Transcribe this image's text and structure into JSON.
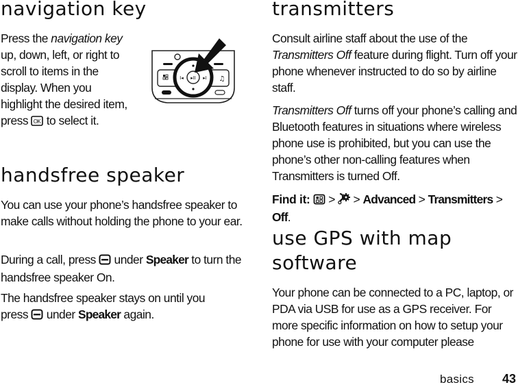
{
  "left": {
    "nav_heading": "navigation key",
    "nav_p1_a": "Press the ",
    "nav_p1_em": "navigation key",
    "nav_p1_b": " up, down, left, or right to scroll to items in the display. When you highlight the desired item, press ",
    "nav_p1_c": " to select it.",
    "ok_key_label": "OK",
    "speaker_heading": "handsfree speaker",
    "speaker_p1": "You can use your phone’s handsfree speaker to make calls without holding the phone to your ear.",
    "speaker_p2_a": "During a call, press ",
    "speaker_p2_b": " under ",
    "speaker_p2_strong": "Speaker",
    "speaker_p2_c": " to turn the handsfree speaker On.",
    "speaker_p3_a": "The handsfree speaker stays on until you press ",
    "speaker_p3_b": " under ",
    "speaker_p3_strong": "Speaker",
    "speaker_p3_c": " again."
  },
  "right": {
    "trans_heading": "transmitters",
    "trans_p1_a": "Consult airline staff about the use of the ",
    "trans_p1_em": "Transmitters Off",
    "trans_p1_b": " feature during flight. Turn off your phone whenever instructed to do so by airline staff.",
    "trans_p2_em": "Transmitters Off",
    "trans_p2_b": " turns off your phone’s calling and Bluetooth features in situations where wireless phone use is prohibited, but you can use the phone’s other non-calling features when Transmitters is turned Off.",
    "find_it_label": "Find it:",
    "find_it_sep": " > ",
    "find_it_path": [
      "Advanced",
      "Transmitters",
      "Off"
    ],
    "gps_heading": "use GPS with map software",
    "gps_p1": "Your phone can be connected to a PC, laptop, or PDA via USB for use as a GPS receiver. For more specific information on how to setup your phone for use with your computer please"
  },
  "footer": {
    "section": "basics",
    "page_number": "43"
  }
}
